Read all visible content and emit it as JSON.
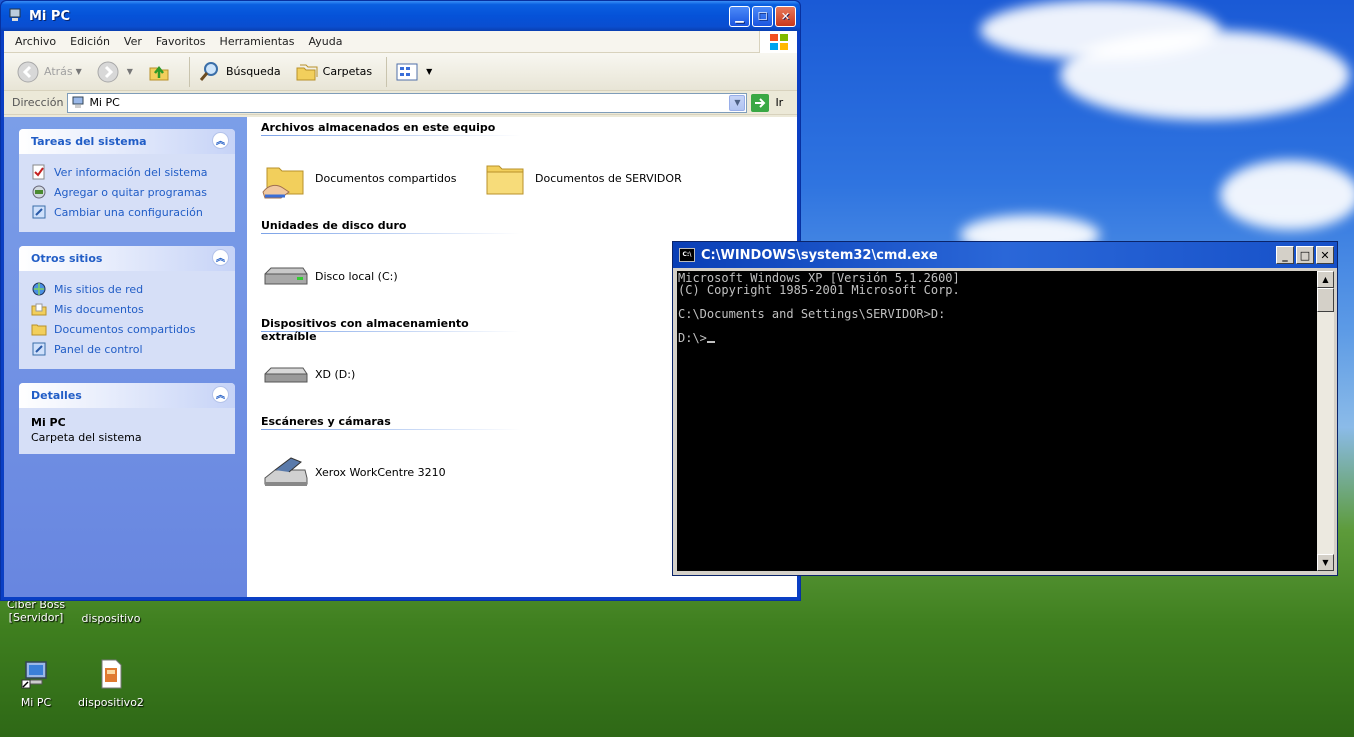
{
  "explorer": {
    "title": "Mi PC",
    "menu": [
      "Archivo",
      "Edición",
      "Ver",
      "Favoritos",
      "Herramientas",
      "Ayuda"
    ],
    "toolbar": {
      "back": "Atrás",
      "search": "Búsqueda",
      "folders": "Carpetas"
    },
    "address": {
      "label": "Dirección",
      "value": "Mi PC",
      "go": "Ir"
    },
    "tasks": {
      "title": "Tareas del sistema",
      "links": [
        "Ver información del sistema",
        "Agregar o quitar programas",
        "Cambiar una configuración"
      ]
    },
    "other_places": {
      "title": "Otros sitios",
      "links": [
        "Mis sitios de red",
        "Mis documentos",
        "Documentos compartidos",
        "Panel de control"
      ]
    },
    "details": {
      "title": "Detalles",
      "name": "Mi PC",
      "desc": "Carpeta del sistema"
    },
    "groups": [
      {
        "header": "Archivos almacenados en este equipo",
        "items": [
          "Documentos compartidos",
          "Documentos de SERVIDOR"
        ]
      },
      {
        "header": "Unidades de disco duro",
        "items": [
          "Disco local (C:)"
        ]
      },
      {
        "header": "Dispositivos con almacenamiento extraíble",
        "items": [
          "XD (D:)"
        ]
      },
      {
        "header": "Escáneres y cámaras",
        "items": [
          "Xerox WorkCentre 3210"
        ]
      }
    ]
  },
  "cmd": {
    "title": "C:\\WINDOWS\\system32\\cmd.exe",
    "icon_text": "C:\\",
    "lines": [
      "Microsoft Windows XP [Versión 5.1.2600]",
      "(C) Copyright 1985-2001 Microsoft Corp.",
      "",
      "C:\\Documents and Settings\\SERVIDOR>D:",
      "",
      "D:\\>"
    ]
  },
  "desktop": {
    "icons": [
      "Ciber Boss [Servidor]",
      "dispositivo",
      "Mi PC",
      "dispositivo2"
    ]
  }
}
